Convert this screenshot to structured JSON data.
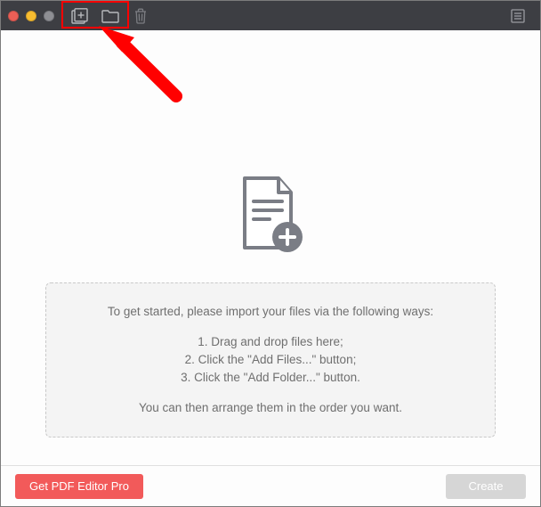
{
  "toolbar": {
    "add_files_tooltip": "Add Files…",
    "add_folder_tooltip": "Add Folder…",
    "delete_tooltip": "Delete",
    "list_tooltip": "List"
  },
  "main": {
    "instructions": {
      "lead": "To get started, please import your files via the following ways:",
      "step1": "1. Drag and drop files here;",
      "step2": "2. Click the \"Add Files...\" button;",
      "step3": "3. Click the \"Add Folder...\" button.",
      "trailer": "You can then arrange them in the order you want."
    }
  },
  "footer": {
    "get_pro_label": "Get PDF Editor Pro",
    "create_label": "Create"
  },
  "annotation": {
    "purpose": "Red arrow and highlight box pointing to Add Files / Add Folder toolbar buttons"
  }
}
